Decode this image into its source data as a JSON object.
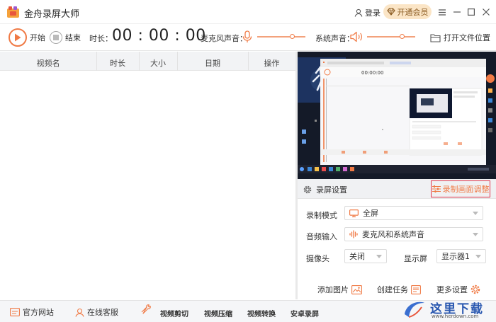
{
  "app": {
    "title": "金舟录屏大师"
  },
  "titlebar": {
    "login": "登录",
    "vip": "开通会员"
  },
  "toolbar": {
    "start": "开始",
    "stop": "结束",
    "duration_label": "时长：",
    "timer": "00 : 00 : 00",
    "mic_label": "麦克风声音：",
    "mic_level": 0.75,
    "sys_label": "系统声音：",
    "sys_level": 0.75,
    "open_folder": "打开文件位置"
  },
  "list": {
    "columns": [
      "视频名",
      "时长",
      "大小",
      "日期",
      "操作"
    ],
    "rows": []
  },
  "settings": {
    "title": "录屏设置",
    "adjust": "录制画面调整",
    "mode_label": "录制模式",
    "mode_value": "全屏",
    "audio_label": "音频输入",
    "audio_value": "麦克风和系统声音",
    "camera_label": "摄像头",
    "camera_value": "关闭",
    "display_label": "显示屏",
    "display_value": "显示器1",
    "add_image": "添加图片",
    "create_task": "创建任务",
    "more_settings": "更多设置"
  },
  "footer": {
    "website": "官方网站",
    "service": "在线客服",
    "tools": [
      "视频剪切",
      "视频压缩",
      "视频转换",
      "安卓录屏"
    ]
  },
  "watermark": {
    "text": "这里下载",
    "url": "www.herdown.com"
  },
  "colors": {
    "accent": "#f07a45",
    "highlight": "#e0334a",
    "vip_bg": "#fbe5c6"
  }
}
